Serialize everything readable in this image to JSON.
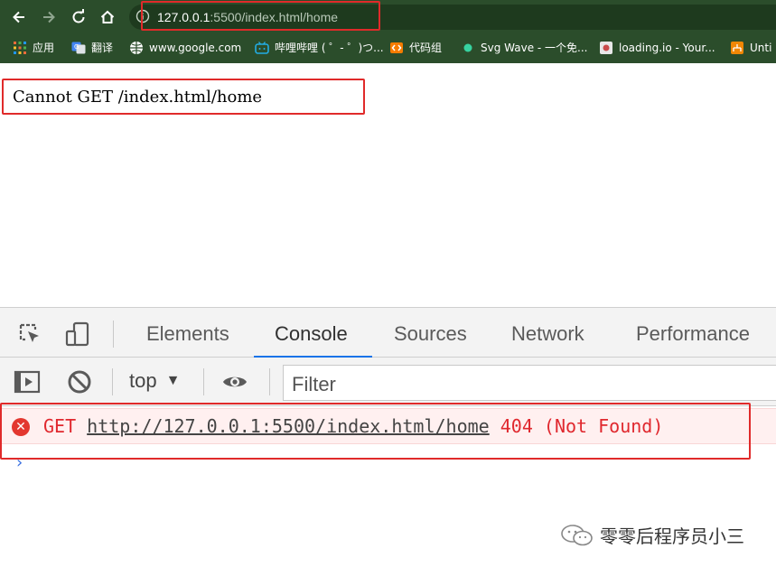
{
  "browser": {
    "url_host": "127.0.0.1",
    "url_rest": ":5500/index.html/home",
    "bookmarks": [
      {
        "label": "应用",
        "icon": "apps-grid-icon"
      },
      {
        "label": "翻译",
        "icon": "translate-icon"
      },
      {
        "label": "www.google.com",
        "icon": "globe-icon"
      },
      {
        "label": "哔哩哔哩 ( ゜- ゜)つ...",
        "icon": "bilibili-icon"
      },
      {
        "label": "代码组",
        "icon": "code-icon"
      },
      {
        "label": "Svg Wave - 一个免...",
        "icon": "dot-icon"
      },
      {
        "label": "loading.io - Your...",
        "icon": "loading-icon"
      },
      {
        "label": "Unti",
        "icon": "diagram-icon"
      }
    ]
  },
  "page": {
    "message": "Cannot GET /index.html/home"
  },
  "devtools": {
    "tabs": [
      "Elements",
      "Console",
      "Sources",
      "Network",
      "Performance"
    ],
    "active_tab": "Console",
    "context": "top",
    "filter_placeholder": "Filter",
    "error": {
      "method": "GET",
      "url": "http://127.0.0.1:5500/index.html/home",
      "status": "404 (Not Found)"
    },
    "prompt": "›"
  },
  "watermark": {
    "text": "零零后程序员小三"
  },
  "colors": {
    "chrome_bg": "#2b4d2b",
    "highlight": "#e02a2a",
    "error_text": "#e0282e",
    "error_bg": "#fff0f0",
    "active_tab_underline": "#1a73e8"
  }
}
